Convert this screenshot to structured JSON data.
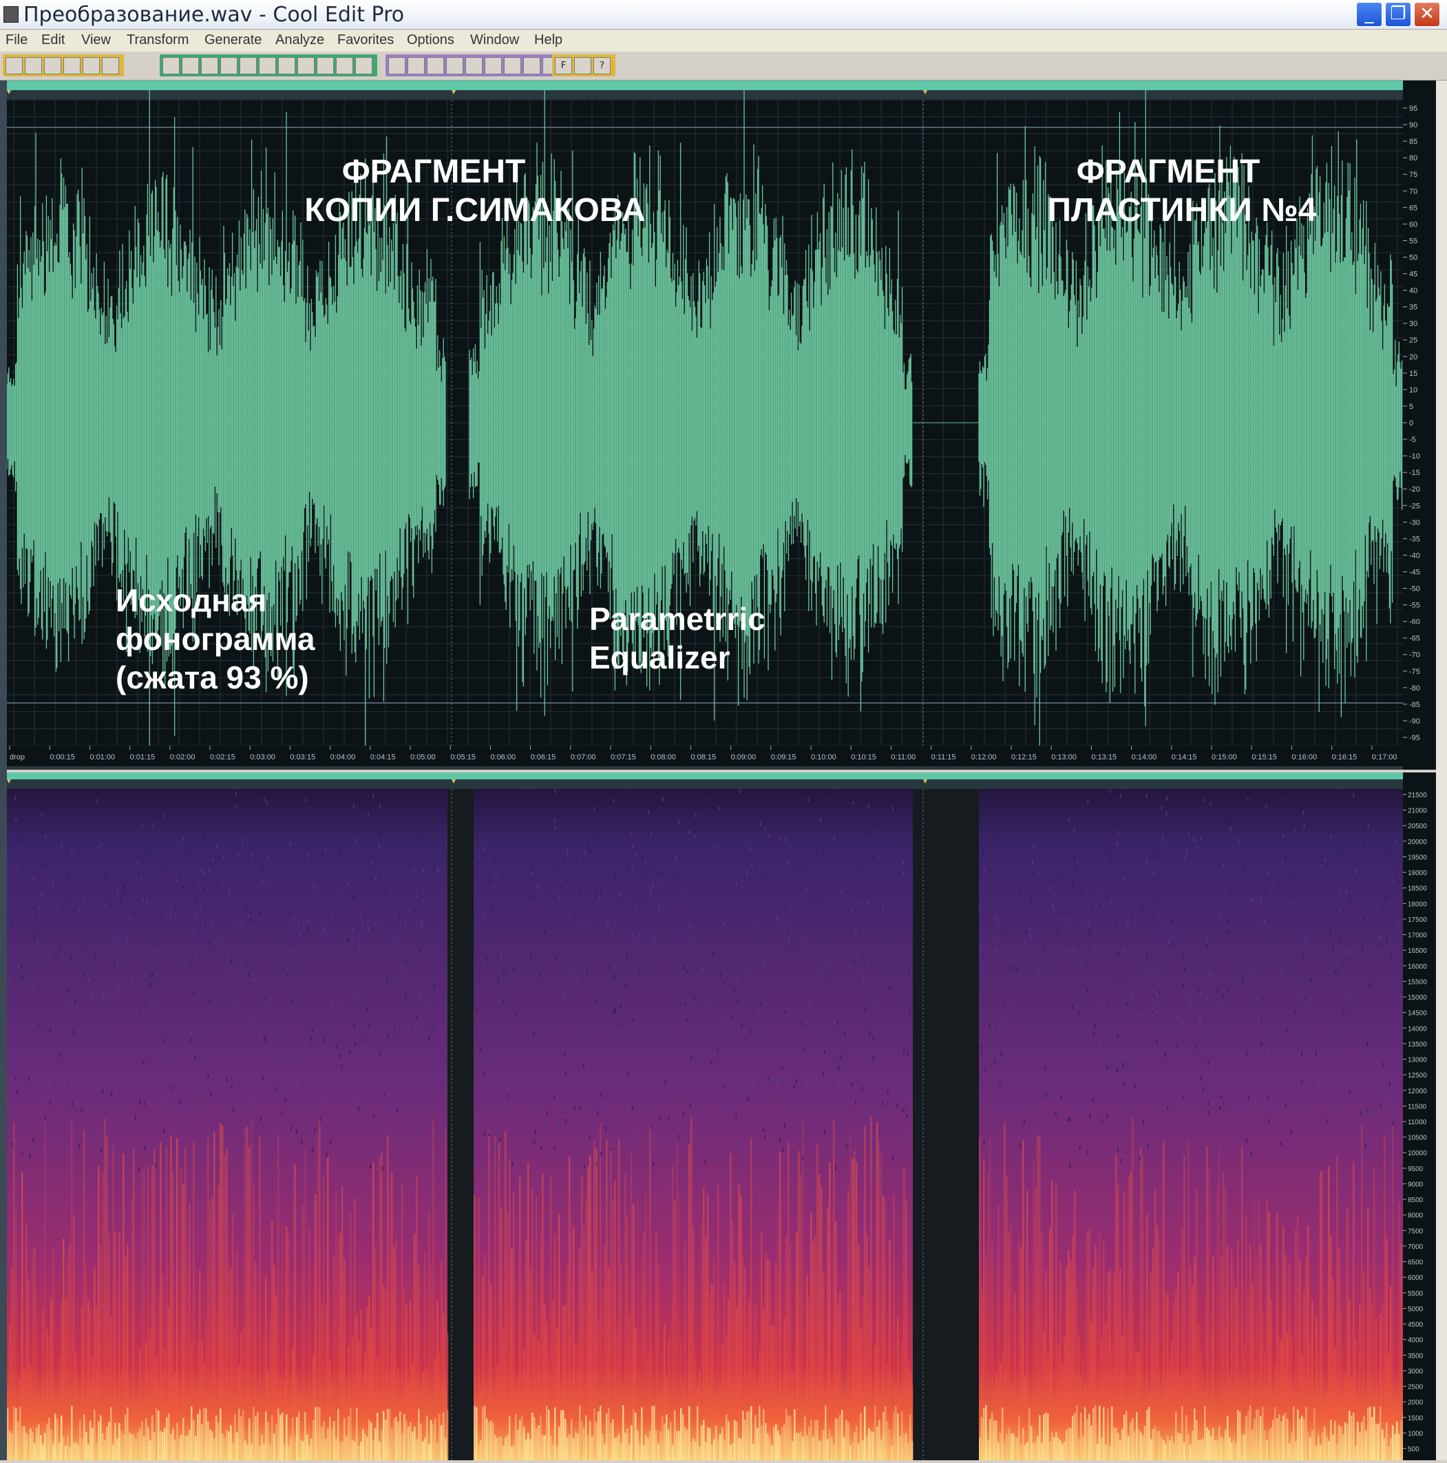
{
  "window": {
    "title": "Преобразование.wav - Cool Edit Pro",
    "controls": {
      "minimize": "_",
      "maximize": "❐",
      "close": "✕"
    }
  },
  "menu": [
    "File",
    "Edit",
    "View",
    "Transform",
    "Generate",
    "Analyze",
    "Favorites",
    "Options",
    "Window",
    "Help"
  ],
  "toolbar": {
    "groups": [
      {
        "color": "#e0b73a",
        "icons": [
          "multitrack-view-icon",
          "new-file-icon",
          "open-file-icon",
          "save-icon",
          "save-all-icon",
          "close-file-icon"
        ]
      },
      {
        "color": "#3fa86d",
        "icons": [
          "undo-icon",
          "redo-icon",
          "repeat-icon",
          "copy-icon",
          "copy-to-new-icon",
          "cut-icon",
          "paste-icon",
          "paste-new-icon",
          "mix-paste-icon",
          "crop-icon",
          "zoom-icon"
        ]
      },
      {
        "color": "#9a7fc4",
        "icons": [
          "waveform-view-icon",
          "spectral-view-icon",
          "settings-icon",
          "info-icon",
          "grid-icon",
          "grid2-icon",
          "frequency-icon",
          "page-icon",
          "help-page-icon"
        ]
      },
      {
        "color": "#e0b73a",
        "icons": [
          "favorites-icon",
          "script-icon",
          "help-icon"
        ]
      }
    ],
    "labels": {
      "favorites-icon": "F",
      "help-icon": "?"
    }
  },
  "overlays": {
    "copy_title_line1": "ФРАГМЕНТ",
    "copy_title_line2": "КОПИИ Г.СИМАКОВА",
    "record_title_line1": "ФРАГМЕНТ",
    "record_title_line2": "ПЛАСТИНКИ №4",
    "source_line1": "Исходная",
    "source_line2": "фонограмма",
    "source_line3": "(сжата 93 %)",
    "eq_line1": "Parametrric",
    "eq_line2": "Equalizer"
  },
  "time_ruler": [
    "drop",
    "0:00:15",
    "0:01:00",
    "0:01:15",
    "0:02:00",
    "0:02:15",
    "0:03:00",
    "0:03:15",
    "0:04:00",
    "0:04:15",
    "0:05:00",
    "0:05:15",
    "0:06:00",
    "0:06:15",
    "0:07:00",
    "0:07:15",
    "0:08:00",
    "0:08:15",
    "0:09:00",
    "0:09:15",
    "0:10:00",
    "0:10:15",
    "0:11:00",
    "0:11:15",
    "0:12:00",
    "0:12:15",
    "0:13:00",
    "0:13:15",
    "0:14:00",
    "0:14:15",
    "0:15:00",
    "0:15:15",
    "0:16:00",
    "0:16:15",
    "0:17:00"
  ],
  "db_scale": [
    95,
    90,
    85,
    80,
    75,
    70,
    65,
    60,
    55,
    50,
    45,
    40,
    35,
    30,
    25,
    20,
    15,
    10,
    5,
    0,
    -5,
    -10,
    -15,
    -20,
    -25,
    -30,
    -35,
    -40,
    -45,
    -50,
    -55,
    -60,
    -65,
    -70,
    -75,
    -80,
    -85,
    -90,
    -95
  ],
  "hz_scale": [
    21500,
    21000,
    20500,
    20000,
    19500,
    19000,
    18500,
    18000,
    17500,
    17000,
    16500,
    16000,
    15500,
    15000,
    14500,
    14000,
    13500,
    13000,
    12500,
    12000,
    11500,
    11000,
    10500,
    10000,
    9500,
    9000,
    8500,
    8000,
    7500,
    7000,
    6500,
    6000,
    5500,
    5000,
    4500,
    4000,
    3500,
    3000,
    2500,
    2000,
    1500,
    1000,
    500
  ],
  "colors": {
    "waveform": "#6cc69e",
    "background": "#0c1317",
    "grid": "#243038",
    "ruler": "#5fc8a8",
    "spec_low": "#2a1a55",
    "spec_mid": "#b32b6b",
    "spec_high": "#f5e07a"
  }
}
